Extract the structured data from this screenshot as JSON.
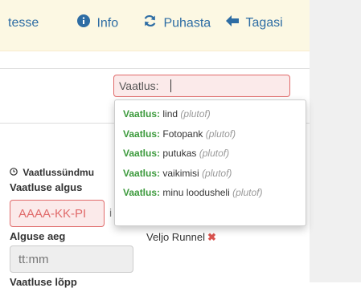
{
  "toolbar": {
    "first_label": "tesse",
    "info_label": "Info",
    "clear_label": "Puhasta",
    "back_label": "Tagasi"
  },
  "search": {
    "value": "Vaatlus:"
  },
  "dropdown": {
    "items": [
      {
        "key": "Vaatlus:",
        "text": "lind",
        "source": "(plutof)"
      },
      {
        "key": "Vaatlus:",
        "text": "Fotopank",
        "source": "(plutof)"
      },
      {
        "key": "Vaatlus:",
        "text": "putukas",
        "source": "(plutof)"
      },
      {
        "key": "Vaatlus:",
        "text": "vaikimisi",
        "source": "(plutof)"
      },
      {
        "key": "Vaatlus:",
        "text": "minu loodusheli",
        "source": "(plutof)"
      }
    ]
  },
  "form": {
    "event_label": "Vaatlussündmu",
    "start_label": "Vaatluse algus",
    "date_placeholder": "AAAA-KK-PI",
    "date_suffix": "i",
    "time_label": "Alguse aeg",
    "time_placeholder": "tt:mm",
    "end_label": "Vaatluse lõpp",
    "observer_name": "Veljo Runnel",
    "remove_symbol": "✖"
  },
  "colors": {
    "accent_link": "#2e6da4",
    "toolbar_bg": "#fcf8e3",
    "error_border": "#e06a6a",
    "error_bg": "#fbeaea",
    "match_green": "#3c9a3c"
  }
}
